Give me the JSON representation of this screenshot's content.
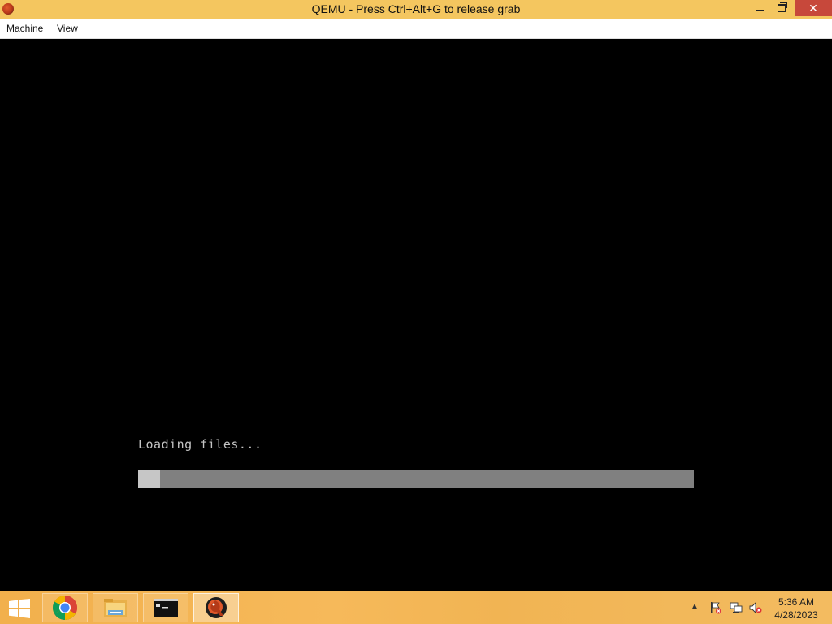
{
  "window": {
    "title": "QEMU - Press Ctrl+Alt+G to release grab",
    "buttons": {
      "close_glyph": "✕"
    }
  },
  "menubar": {
    "items": [
      {
        "label": "Machine"
      },
      {
        "label": "View"
      }
    ]
  },
  "screen": {
    "loading_text": "Loading files...",
    "progress": 0.04,
    "colors": {
      "text": "#c4c4c4",
      "track": "#808080",
      "fill": "#c6c6c6"
    }
  },
  "taskbar": {
    "apps": [
      {
        "name": "chrome",
        "icon": "chrome-icon"
      },
      {
        "name": "file-explorer",
        "icon": "folder-icon"
      },
      {
        "name": "command-prompt",
        "icon": "cmd-icon"
      },
      {
        "name": "qemu",
        "icon": "qemu-icon",
        "active": true
      }
    ],
    "tray": {
      "overflow_glyph": "▲",
      "icons": [
        "action-center-flag-icon",
        "network-icon",
        "volume-muted-icon"
      ]
    },
    "clock": {
      "time": "5:36 AM",
      "date": "4/28/2023"
    }
  }
}
